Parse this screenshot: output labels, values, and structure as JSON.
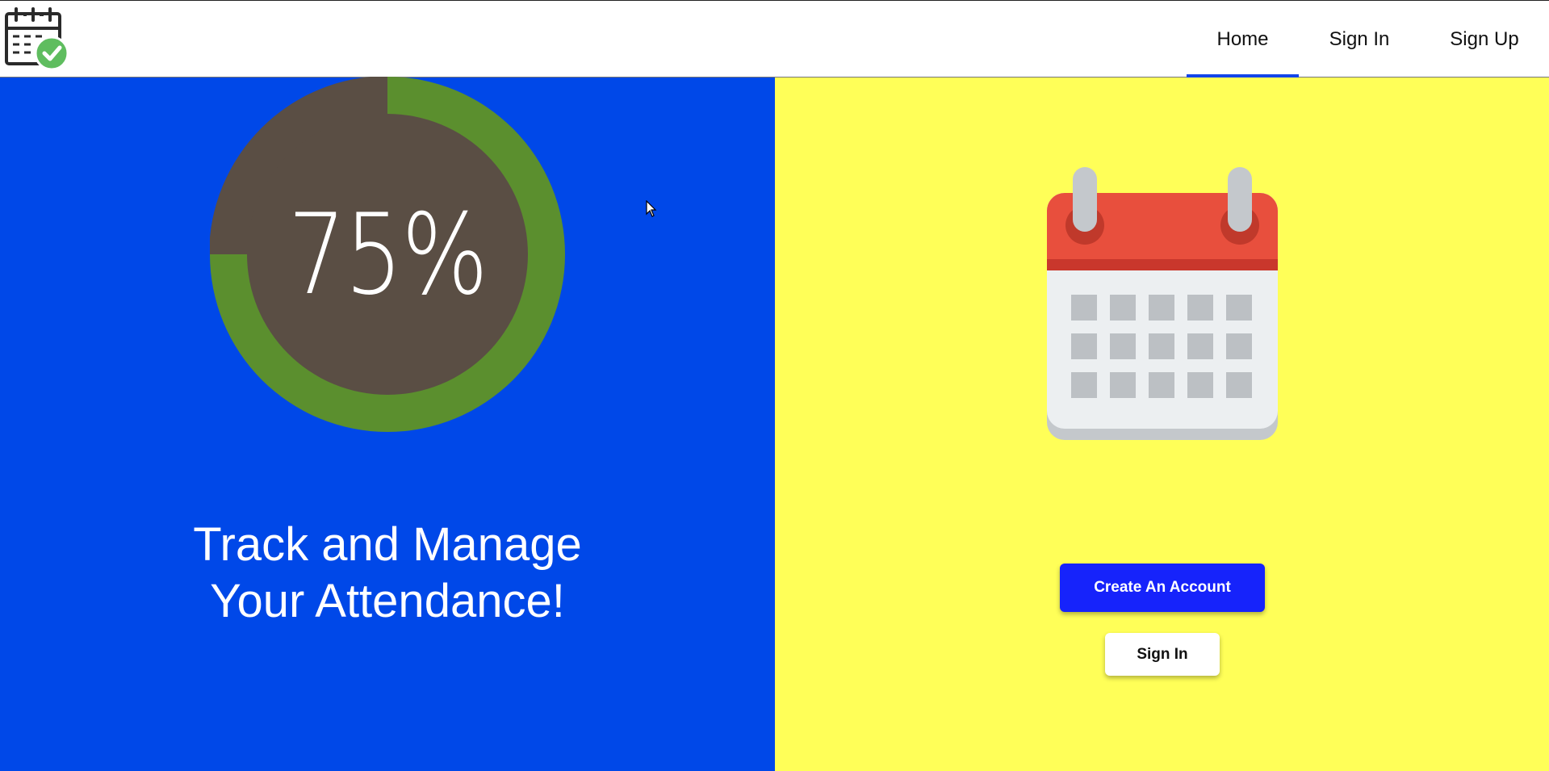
{
  "nav": {
    "items": [
      {
        "label": "Home",
        "active": true
      },
      {
        "label": "Sign In",
        "active": false
      },
      {
        "label": "Sign Up",
        "active": false
      }
    ],
    "active_color": "#1446e8"
  },
  "hero": {
    "progress": {
      "value_text": "75%",
      "value": 0.75,
      "ring_color": "#5b8f2e",
      "inner_color": "#5a4e44"
    },
    "headline": {
      "line1": "Track and Manage",
      "line2": "Your Attendance!"
    },
    "colors": {
      "left_bg": "#0048e8",
      "right_bg": "#ffff58"
    }
  },
  "actions": {
    "create_account_label": "Create An Account",
    "sign_in_label": "Sign In",
    "primary_color": "#1623fb"
  },
  "icons": {
    "logo": "calendar-check-icon",
    "illustration": "calendar-icon",
    "cursor": "mouse-pointer-icon"
  }
}
